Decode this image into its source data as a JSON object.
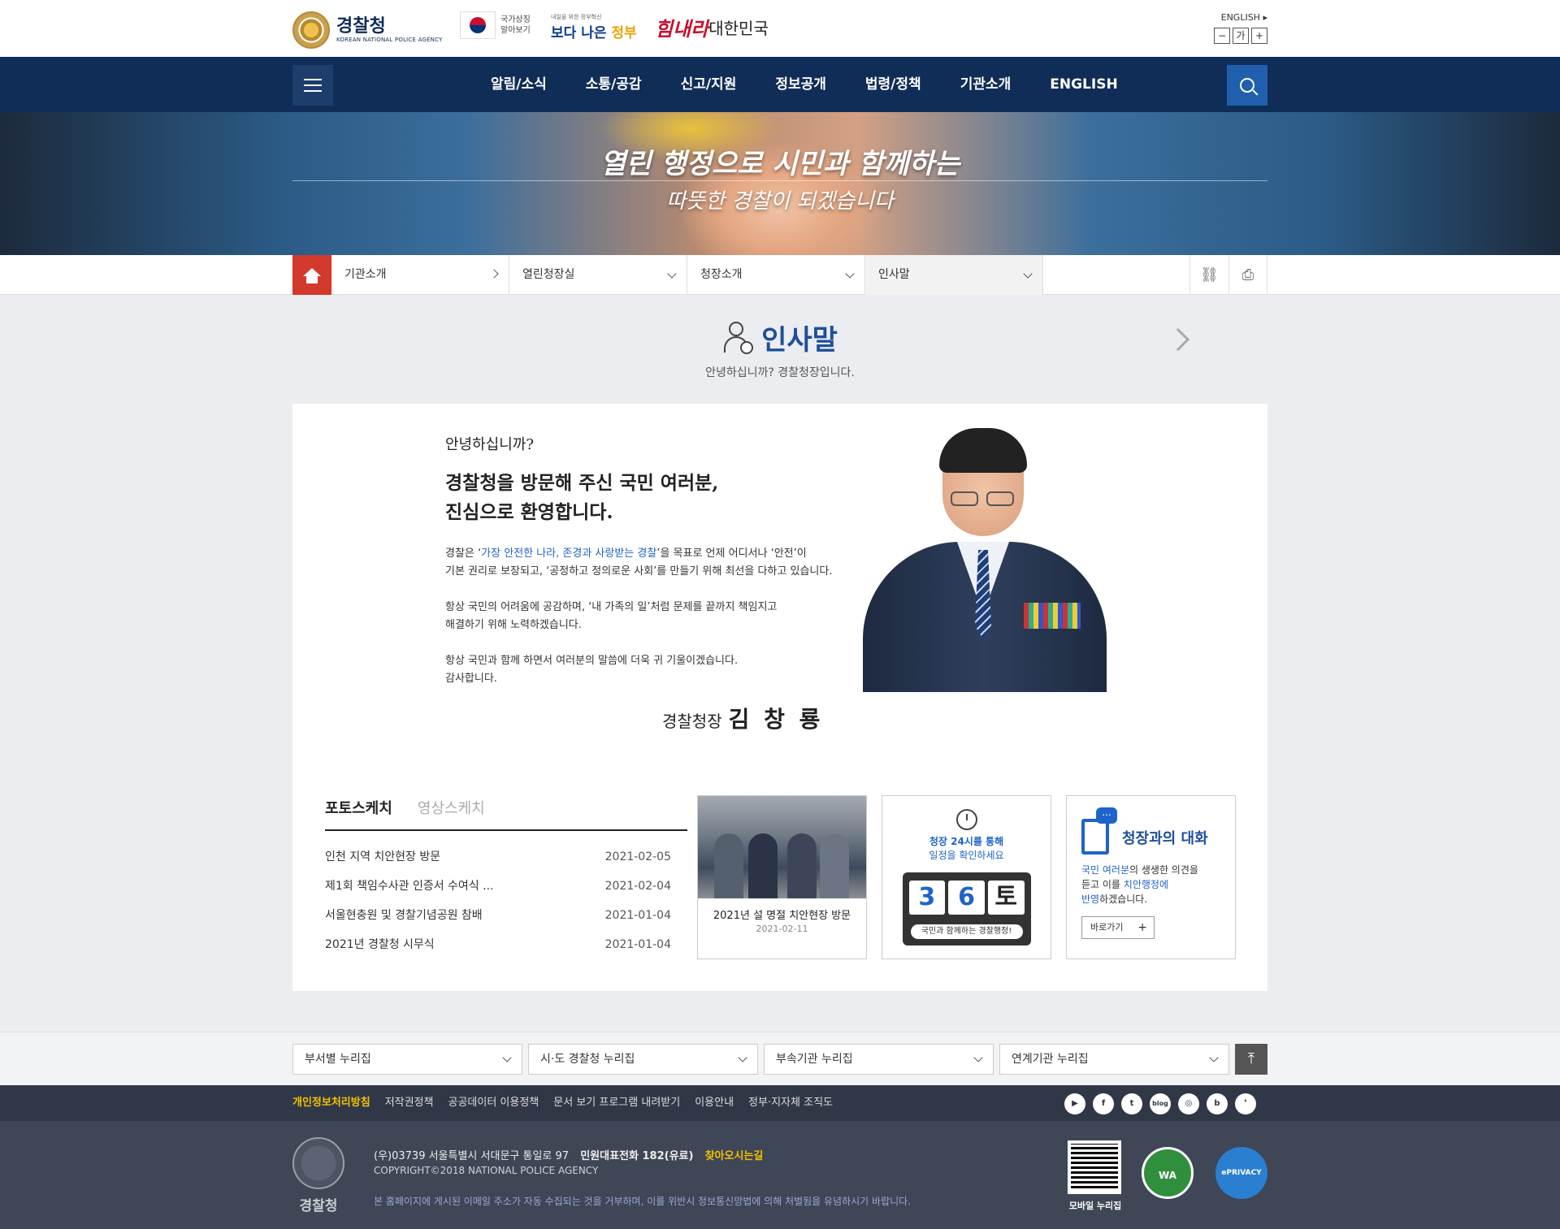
{
  "header": {
    "logo_title": "경찰청",
    "logo_subtitle": "KOREAN NATIONAL POLICE AGENCY",
    "gov_symbol_label_1": "국가상징",
    "gov_symbol_label_2": "알아보기",
    "better_gov_small": "내일을 위한 정부혁신",
    "better_gov_main": "보다 나은",
    "better_gov_accent": "정부",
    "slogan_main": "힘내라",
    "slogan_sub": "대한민국",
    "lang_link": "ENGLISH",
    "font_minus": "−",
    "font_label": "가",
    "font_plus": "+"
  },
  "gnb": {
    "items": [
      "알림/소식",
      "소통/공감",
      "신고/지원",
      "정보공개",
      "법령/정책",
      "기관소개",
      "ENGLISH"
    ]
  },
  "banner": {
    "line1": "열린 행정으로 시민과 함께하는",
    "line2": "따뜻한 경찰이 되겠습니다"
  },
  "breadcrumb": {
    "items": [
      "기관소개",
      "열린청장실",
      "청장소개",
      "인사말"
    ]
  },
  "page": {
    "title": "인사말",
    "subtitle": "안녕하십니까? 경찰청장입니다."
  },
  "greeting": {
    "hello": "안녕하십니까?",
    "headline_1": "경찰청을 방문해 주신 국민 여러분,",
    "headline_2": "진심으로 환영합니다.",
    "p1_pre": "경찰은 ‘",
    "p1_em": "가장 안전한 나라, 존경과 사랑받는 경찰",
    "p1_post": "’을 목표로 언제 어디서나 ‘안전’이",
    "p1_line2": "기본 권리로 보장되고, ‘공정하고 정의로운 사회’를 만들기 위해 최선을 다하고 있습니다.",
    "p2_line1": "항상 국민의 어려움에 공감하며, ‘내 가족의 일’처럼 문제를 끝까지 책임지고",
    "p2_line2": "해결하기 위해 노력하겠습니다.",
    "p3_line1": "항상 국민과 함께 하면서 여러분의 말씀에 더욱 귀 기울이겠습니다.",
    "p3_line2": "감사합니다.",
    "sign_title": "경찰청장",
    "sign_name": "김 창 룡"
  },
  "tabs": {
    "photo": "포토스케치",
    "video": "영상스케치"
  },
  "news": [
    {
      "title": "인천 지역 치안현장 방문",
      "date": "2021-02-05"
    },
    {
      "title": "제1회 책임수사관 인증서 수여식 ...",
      "date": "2021-02-04"
    },
    {
      "title": "서울현충원 및 경찰기념공원 참배",
      "date": "2021-01-04"
    },
    {
      "title": "2021년 경찰청 시무식",
      "date": "2021-01-04"
    }
  ],
  "photo_card": {
    "caption": "2021년 설 명절 치안현장 방문",
    "date": "2021-02-11"
  },
  "schedule": {
    "line1": "청장 24시를 통해",
    "line2": "일정을 확인하세요",
    "digit1": "3",
    "digit2": "6",
    "day": "토",
    "caption": "국민과 함께하는 경찰행정!"
  },
  "talk": {
    "title": "청장과의 대화",
    "desc_em1": "국민 여러분",
    "desc_1": "의 생생한 의견을",
    "desc_2": "듣고 이를 ",
    "desc_em2": "치안행정에",
    "desc_em3": "반영",
    "desc_3": "하겠습니다.",
    "button": "바로가기"
  },
  "family_sites": [
    "부서별 누리집",
    "시·도 경찰청 누리집",
    "부속기관 누리집",
    "연계기관 누리집"
  ],
  "top_button": "⤒",
  "footer_links": [
    "개인정보처리방침",
    "저작권정책",
    "공공데이터 이용정책",
    "문서 보기 프로그램 내려받기",
    "이용안내",
    "정부·지자체 조직도"
  ],
  "sns": [
    "▶",
    "f",
    "t",
    "blog",
    "◎",
    "b",
    "❜"
  ],
  "footer": {
    "emblem_name": "경찰청",
    "address": "(우)03739 서울특별시 서대문구 통일로 97",
    "phone": "민원대표전화 182(유료)",
    "directions": "찾아오시는길",
    "copyright": "COPYRIGHT©2018 NATIONAL POLICE AGENCY",
    "notice": "본 홈페이지에 게시된 이메일 주소가 자동 수집되는 것을 거부하며, 이를 위반시 정보통신망법에 의해 처벌됨을 유념하시기 바랍니다.",
    "qr_caption": "모바일 누리집",
    "badge_wa": "WA",
    "badge_privacy": "ePRIVACY"
  },
  "colors": {
    "navy": "#102d57",
    "accent_red": "#d33a2c",
    "link_blue": "#1f64c8",
    "footer_gold": "#f2c200"
  }
}
